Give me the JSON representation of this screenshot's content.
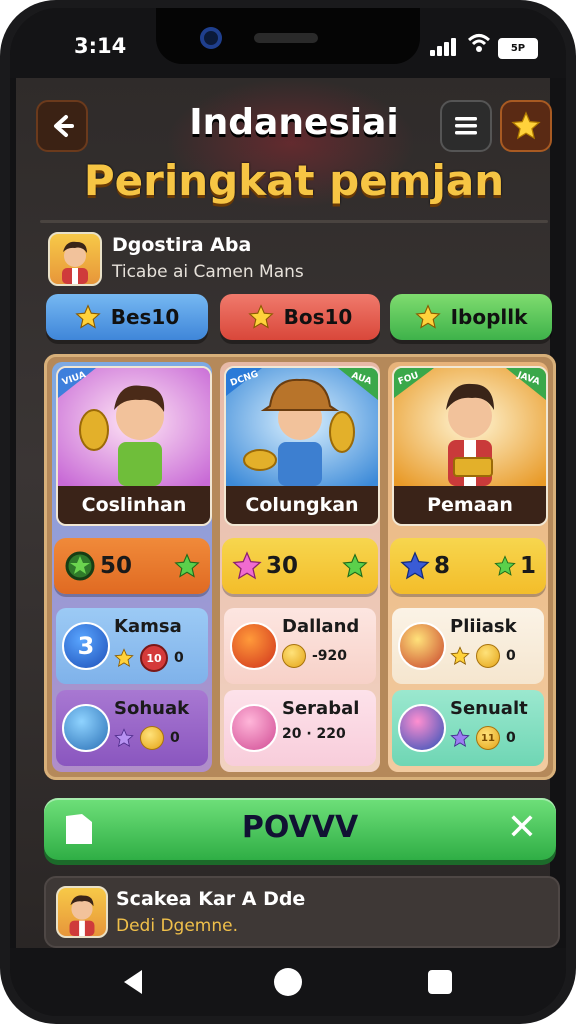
{
  "status": {
    "time": "3:14",
    "battery_label": "5P"
  },
  "header": {
    "title": "Indanesiai",
    "subtitle": "Peringkat pemjan"
  },
  "profile": {
    "name": "Dgostira Aba",
    "description": "Ticabe ai Camen Mans"
  },
  "tabs": [
    {
      "label": "Bes10",
      "color": "#4f95e3"
    },
    {
      "label": "Bos10",
      "color": "#e05a4c"
    },
    {
      "label": "Ibopllk",
      "color": "#52c15a"
    }
  ],
  "columns": [
    {
      "card_label": "Coslinhan",
      "ribbon_left": "VIUA",
      "ribbon_right": "",
      "score": "50",
      "rows": [
        {
          "name": "Kamsa",
          "badge": "3",
          "chip": "10",
          "count": "0"
        },
        {
          "name": "Sohuak",
          "coin": "",
          "count": "0"
        }
      ]
    },
    {
      "card_label": "Colungkan",
      "ribbon_left": "DCNG",
      "ribbon_right": "AUA",
      "score": "30",
      "rows": [
        {
          "name": "Dalland",
          "stat": "-920",
          "count": ""
        },
        {
          "name": "Serabal",
          "stat": "20 · 220",
          "count": ""
        }
      ]
    },
    {
      "card_label": "Pemaan",
      "ribbon_left": "FOU",
      "ribbon_right": "JAVA",
      "score": "8",
      "score_right": "1",
      "rows": [
        {
          "name": "Pliiask",
          "count": "0"
        },
        {
          "name": "Senualt",
          "chip": "11",
          "count": "0"
        }
      ]
    }
  ],
  "action": {
    "label": "POVVV"
  },
  "footer": {
    "name": "Scakea Kar A Dde",
    "description": "Dedi Dgemne."
  },
  "icons": {
    "back": "back-arrow-icon",
    "menu": "hamburger-icon",
    "star": "star-icon",
    "close": "close-icon"
  }
}
